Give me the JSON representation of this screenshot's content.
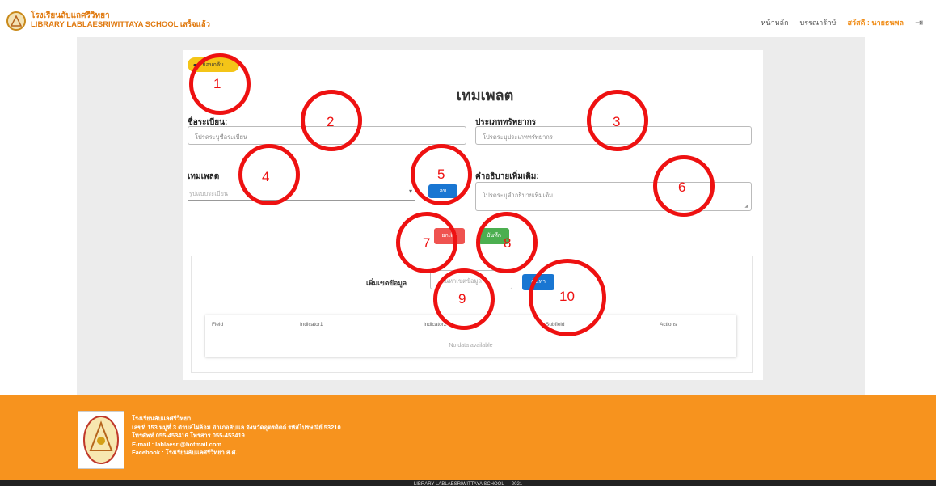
{
  "header": {
    "school_name_th": "โรงเรียนลับแลศรีวิทยา",
    "school_name_en": "LIBRARY LABLAESRIWITTAYA SCHOOL เสร็จแล้ว",
    "nav_home": "หน้าหลัก",
    "nav_librarian": "บรรณารักษ์",
    "nav_user": "สวัสดี : นายธนพล"
  },
  "form": {
    "back_label": "ย้อนกลับ",
    "title": "เทมเพลต",
    "register_label": "ชื่อระเบียน:",
    "register_placeholder": "โปรดระบุชื่อระเบียน",
    "resource_type_label": "ประเภททรัพยากร",
    "resource_type_placeholder": "โปรดระบุประเภททรัพยากร",
    "template_label": "เทมเพลต",
    "template_placeholder": "รูปแบบระเบียน",
    "delete_label": "ลบ",
    "description_label": "คำอธิบายเพิ่มเติม:",
    "description_placeholder": "โปรดระบุคำอธิบายเพิ่มเติม",
    "cancel_label": "ยกเลิก",
    "save_label": "บันทึก"
  },
  "data_section": {
    "add_label": "เพิ่มเขตข้อมูล",
    "search_placeholder": "ค้นหาเขตข้อมูล",
    "search_button": "ค้นหา",
    "columns": [
      "Field",
      "Indicator1",
      "Indicator2",
      "Subfield",
      "Actions"
    ],
    "no_data": "No data available"
  },
  "annotations": [
    "1",
    "2",
    "3",
    "4",
    "5",
    "6",
    "7",
    "8",
    "9",
    "10"
  ],
  "footer": {
    "line1": "โรงเรียนลับแลศรีวิทยา",
    "line2": "เลขที่ 153 หมู่ที่ 3 ตำบลไผ่ล้อม อำเภอลับแล จังหวัดอุตรดิตถ์ รหัสไปรษณีย์ 53210",
    "line3": "โทรศัพท์ 055-453416 โทรสาร 055-453419",
    "line4": "E-mail : lablaesri@hotmail.com",
    "line5": "Facebook : โรงเรียนลับแลศรีวิทยา ส.ศ.",
    "copyright": "LIBRARY LABLAESRIWITTAYA SCHOOL — 2021"
  },
  "colors": {
    "accent": "#f7931e",
    "annotation": "#ee1111",
    "primary": "#1976d2"
  }
}
